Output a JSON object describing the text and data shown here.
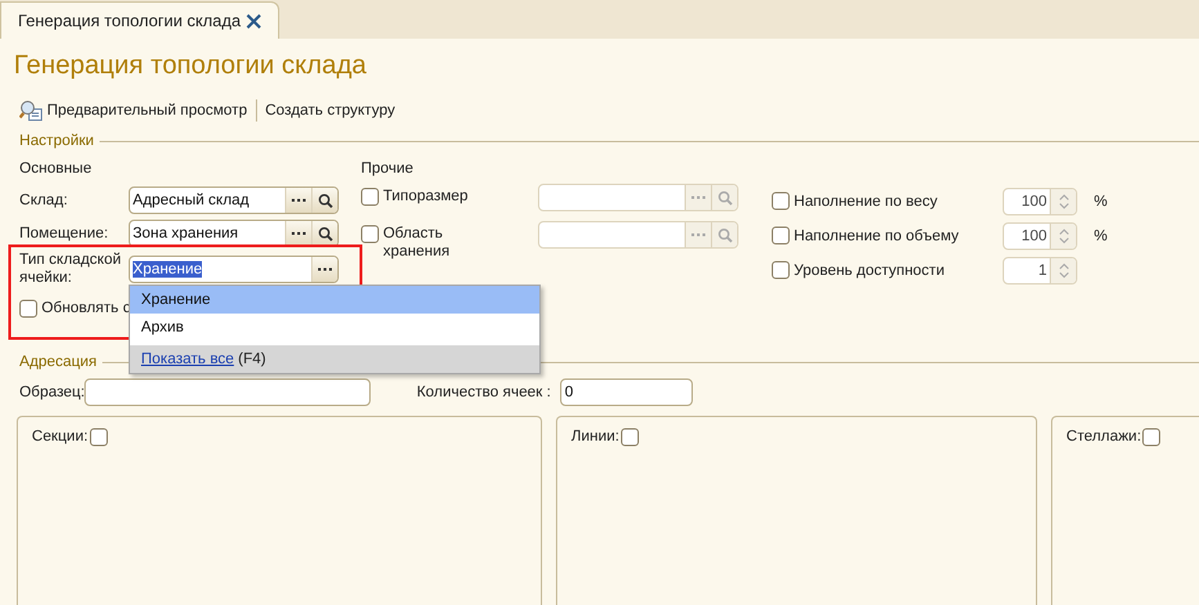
{
  "tab": {
    "label": "Генерация топологии склада",
    "selected": true
  },
  "title": "Генерация топологии склада",
  "toolbar": [
    {
      "label": "Предварительный просмотр",
      "kind": "preview"
    },
    {
      "label": "Создать структуру",
      "kind": "plain"
    }
  ],
  "settings": {
    "title": "Настройки",
    "main": {
      "title": "Основные",
      "fields": [
        {
          "label": "Склад:",
          "value": "Адресный склад",
          "kind": "lookup"
        },
        {
          "label": "Помещение:",
          "value": "Зона хранения",
          "kind": "lookup"
        },
        {
          "label": "Тип складской ячейки:",
          "value": "Хранение",
          "kind": "select"
        }
      ],
      "update": {
        "label": "Обновлять с",
        "checked": false
      }
    },
    "other": {
      "title": "Прочие",
      "rows": [
        {
          "label": "Типоразмер",
          "checked": false,
          "disabled": true
        },
        {
          "label": "Область хранения",
          "checked": false,
          "disabled": true
        }
      ]
    },
    "limits": [
      {
        "label": "Наполнение по весу",
        "checked": false,
        "value": "100",
        "unit": "%",
        "disabled": true
      },
      {
        "label": "Наполнение по объему",
        "checked": false,
        "value": "100",
        "unit": "%",
        "disabled": true
      },
      {
        "label": "Уровень доступности",
        "checked": false,
        "value": "1",
        "disabled": true
      }
    ]
  },
  "dropdown": {
    "options": [
      {
        "label": "Хранение",
        "selected": true
      },
      {
        "label": "Архив",
        "selected": false
      }
    ],
    "show_all": "Показать все",
    "shortcut": "(F4)"
  },
  "addressing": {
    "title": "Адресация",
    "sample_label": "Образец:",
    "count_label": "Количество ячеек :",
    "count_value": "0",
    "panels": [
      {
        "label": "Секции:",
        "checked": false
      },
      {
        "label": "Линии:",
        "checked": false
      },
      {
        "label": "Стеллажи:",
        "checked": false
      }
    ]
  }
}
